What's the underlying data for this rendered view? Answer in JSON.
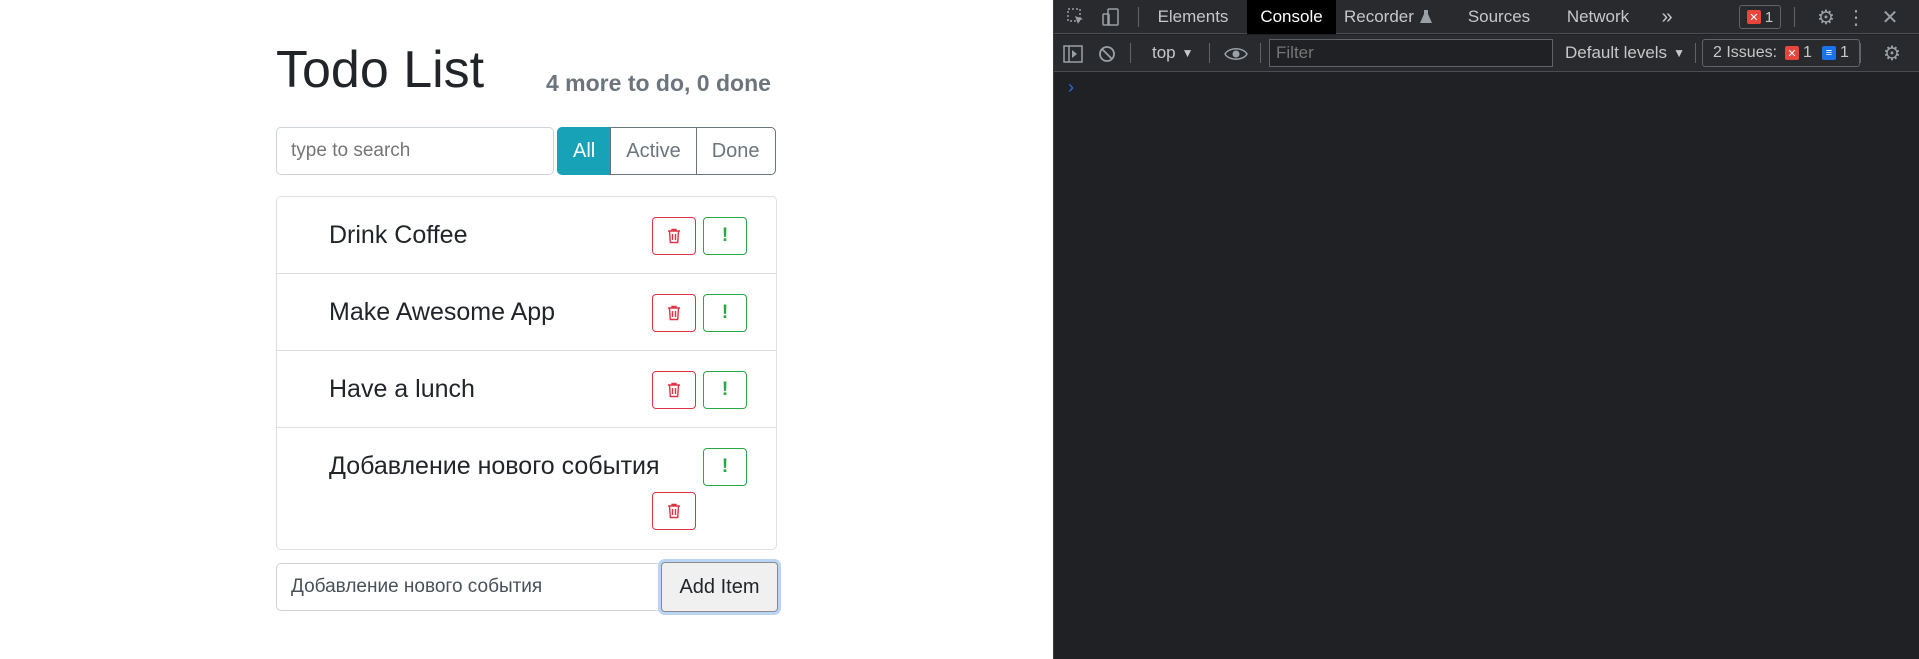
{
  "app": {
    "title": "Todo List",
    "status": "4 more to do, 0 done",
    "search": {
      "placeholder": "type to search"
    },
    "filters": [
      {
        "label": "All",
        "active": true
      },
      {
        "label": "Active",
        "active": false
      },
      {
        "label": "Done",
        "active": false
      }
    ],
    "todos": [
      {
        "label": "Drink Coffee",
        "delete_icon": "trash-icon",
        "important_icon": "exclamation-icon"
      },
      {
        "label": "Make Awesome App",
        "delete_icon": "trash-icon",
        "important_icon": "exclamation-icon"
      },
      {
        "label": "Have a lunch",
        "delete_icon": "trash-icon",
        "important_icon": "exclamation-icon"
      },
      {
        "label": "Добавление нового события",
        "delete_icon": "trash-icon",
        "important_icon": "exclamation-icon"
      }
    ],
    "important_glyph": "!",
    "add_form": {
      "value": "Добавление нового события",
      "button_label": "Add Item"
    },
    "colors": {
      "accent": "#17a2b8",
      "danger": "#dc3545",
      "success": "#28a745",
      "muted": "#6c757d"
    }
  },
  "devtools": {
    "tabs": [
      {
        "label": "Elements",
        "active": false
      },
      {
        "label": "Console",
        "active": true
      },
      {
        "label": "Recorder",
        "active": false
      },
      {
        "label": "Sources",
        "active": false
      },
      {
        "label": "Network",
        "active": false
      }
    ],
    "more_tabs_glyph": "»",
    "error_count": "1",
    "toolbar": {
      "context": "top",
      "filter_placeholder": "Filter",
      "levels": "Default levels",
      "issues_label": "2 Issues:",
      "issues_errors": "1",
      "issues_info": "1"
    },
    "prompt_glyph": "›",
    "colors": {
      "background": "#202124",
      "panel": "#292a2d",
      "error": "#e8453c",
      "info": "#1a73e8"
    }
  }
}
